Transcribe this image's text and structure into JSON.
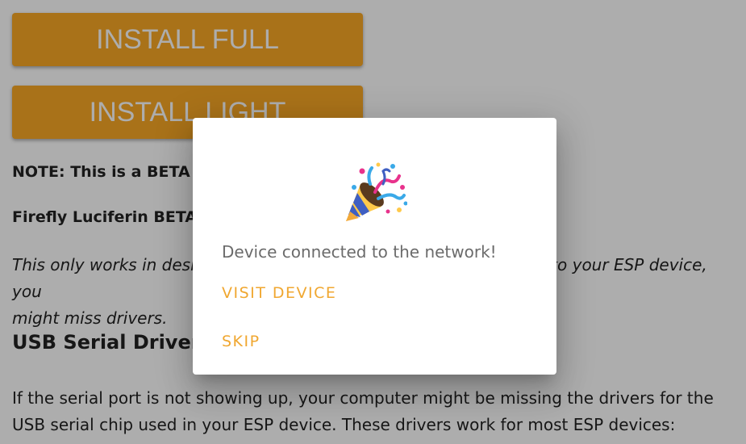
{
  "buttons": {
    "install_full": "INSTALL FULL",
    "install_light": "INSTALL LIGHT"
  },
  "content": {
    "note": "NOTE: This is a BETA",
    "beta_title": "Firefly Luciferin BETA",
    "warning_line1": "This only works in desktop Chrome and Edge. If you can't connect to your ESP device, you",
    "warning_line2": "might miss drivers.",
    "usb_heading": "USB Serial Drivers",
    "paragraph": "If the serial port is not showing up, your computer might be missing the drivers for the USB serial chip used in your ESP device. These drivers work for most ESP devices:"
  },
  "dialog": {
    "icon": "party-popper-icon",
    "message": "Device connected to the network!",
    "visit_label": "VISIT DEVICE",
    "skip_label": "SKIP"
  },
  "colors": {
    "accent": "#f9a825",
    "dialog_action": "#f0a730",
    "overlay": "rgba(0,0,0,0.32)"
  }
}
